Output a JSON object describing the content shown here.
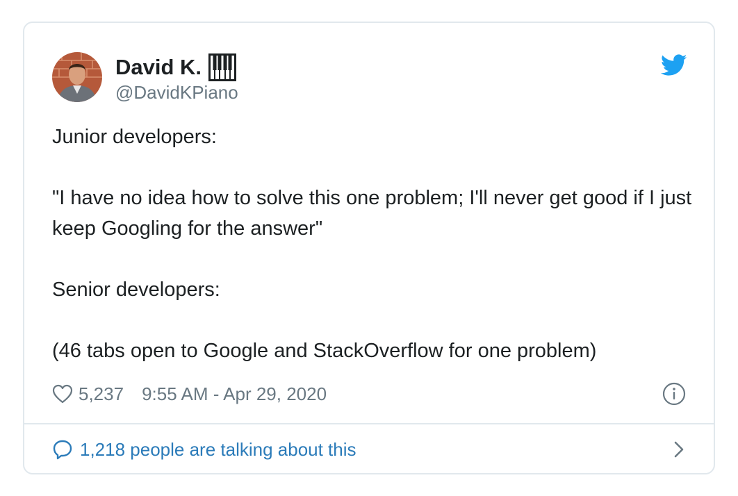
{
  "author": {
    "display_name": "David K.",
    "handle": "@DavidKPiano"
  },
  "icons": {
    "avatar": "avatar-photo",
    "badge": "piano-keys-icon",
    "brand": "twitter-bird-icon",
    "like": "heart-icon",
    "info": "info-icon",
    "reply": "speech-bubble-icon",
    "more": "chevron-right-icon"
  },
  "colors": {
    "brand": "#1da1f2",
    "link": "#2b7bb9",
    "text": "#1c2022",
    "muted": "#697882",
    "border": "#e1e8ed"
  },
  "tweet": {
    "paragraphs": [
      "Junior developers:",
      "\"I have no idea how to solve this one problem; I'll never get good if I just keep Googling for the answer\"",
      "Senior developers:",
      "(46 tabs open to Google and StackOverflow for one problem)"
    ]
  },
  "meta": {
    "likes": "5,237",
    "timestamp": "9:55 AM - Apr 29, 2020"
  },
  "footer": {
    "talking": "1,218 people are talking about this"
  }
}
